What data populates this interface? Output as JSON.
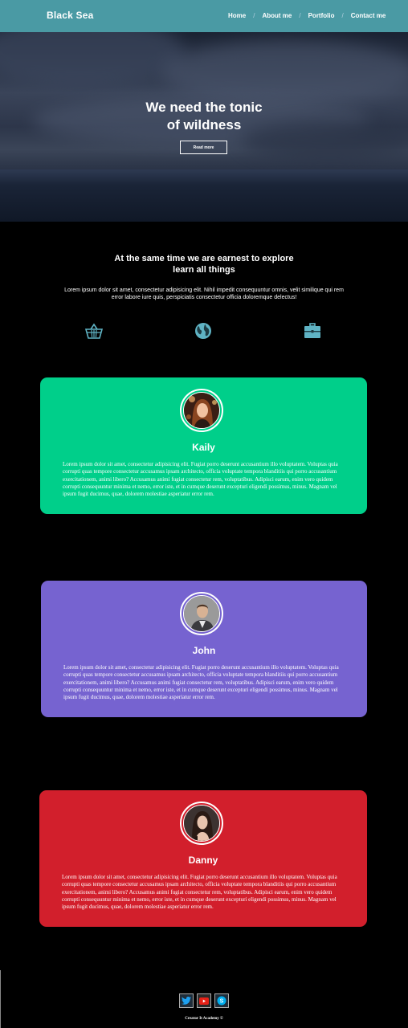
{
  "header": {
    "logo": "Black Sea",
    "nav": [
      {
        "label": "Home"
      },
      {
        "label": "About me"
      },
      {
        "label": "Portfolio"
      },
      {
        "label": "Contact me"
      }
    ],
    "separator": "/"
  },
  "hero": {
    "title_line1": "We need the tonic",
    "title_line2": "of wildness",
    "button_label": "Read more"
  },
  "intro": {
    "title_line1": "At the same time we are earnest to explore",
    "title_line2": "learn all things",
    "text": "Lorem ipsum dolor sit amet, consectetur adipisicing elit. Nihil impedit consequuntur omnis, velit similique qui rem error labore iure quis, perspiciatis consectetur officia doloremque delectus!",
    "icons": [
      "basket-icon",
      "globe-icon",
      "briefcase-icon"
    ]
  },
  "cards": [
    {
      "name": "Kaily",
      "color": "#00cf8a",
      "text": "Lorem ipsum dolor sit amet, consectetur adipisicing elit. Fugiat porro deserunt accusantium illo voluptatem. Voluptas quia corrupti quas tempore consectetur accusamus ipsam architecto, officia voluptate tempora blanditiis qui porro accusantium exercitationem, animi libero? Accusamus animi fugiat consectetur rem, voluptatibus. Adipisci earum, enim vero quidem corrupti consequuntur minima et nemo, error iste, et in cumque deserunt excepturi eligendi possimus, minus. Magnam vel ipsum fugit ducimus, quae, dolorem molestiae asperiatur error rem."
    },
    {
      "name": "John",
      "color": "#7663d0",
      "text": "Lorem ipsum dolor sit amet, consectetur adipisicing elit. Fugiat porro deserunt accusantium illo voluptatem. Voluptas quia corrupti quas tempore consectetur accusamus ipsam architecto, officia voluptate tempora blanditiis qui porro accusantium exercitationem, animi libero? Accusamus animi fugiat consectetur rem, voluptatibus. Adipisci earum, enim vero quidem corrupti consequuntur minima et nemo, error iste, et in cumque deserunt excepturi eligendi possimus, minus. Magnam vel ipsum fugit ducimus, quae, dolorem molestiae asperiatur error rem."
    },
    {
      "name": "Danny",
      "color": "#d21f2c",
      "text": "Lorem ipsum dolor sit amet, consectetur adipisicing elit. Fugiat porro deserunt accusantium illo voluptatem. Voluptas quia corrupti quas tempore consectetur accusamus ipsam architecto, officia voluptate tempora blanditiis qui porro accusantium exercitationem, animi libero? Accusamus animi fugiat consectetur rem, voluptatibus. Adipisci earum, enim vero quidem corrupti consequuntur minima et nemo, error iste, et in cumque deserunt excepturi eligendi possimus, minus. Magnam vel ipsum fugit ducimus, quae, dolorem molestiae asperiatur error rem."
    }
  ],
  "footer": {
    "social": [
      "twitter-icon",
      "youtube-icon",
      "skype-icon"
    ],
    "copyright": "Creator It Academy ©"
  },
  "colors": {
    "accent": "#4a9aa4",
    "icon": "#5fb3c4"
  }
}
